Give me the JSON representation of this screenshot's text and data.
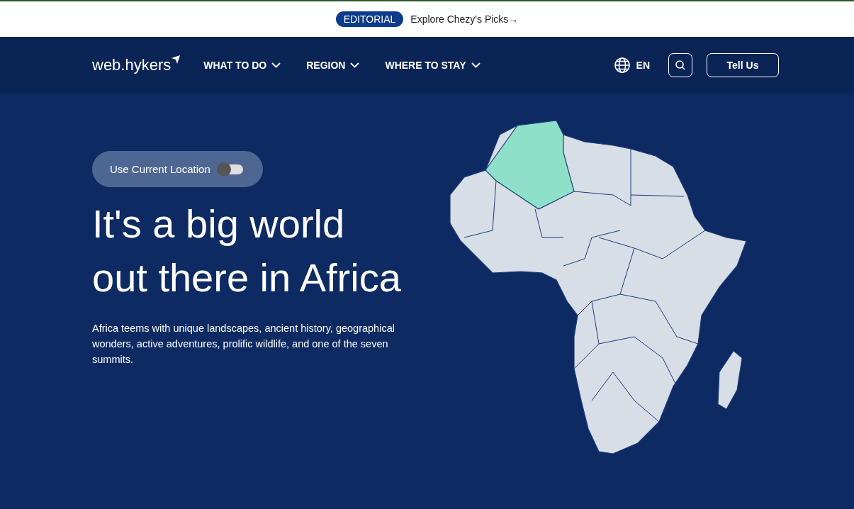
{
  "banner": {
    "badge": "EDITORIAL",
    "link": "Explore Chezy's Picks",
    "arrow": "→"
  },
  "nav": {
    "logo": "web.hykers",
    "menu": [
      {
        "label": "WHAT TO DO"
      },
      {
        "label": "REGION"
      },
      {
        "label": "WHERE TO STAY"
      }
    ],
    "language": "EN",
    "button": "Tell Us"
  },
  "hero": {
    "location_toggle": {
      "label": "Use Current Location",
      "on": false
    },
    "title": "It's a big world out there in Africa",
    "description": "Africa teems with unique landscapes, ancient history, geographical wonders, active adventures, prolific wildlife, and one of the seven summits."
  }
}
